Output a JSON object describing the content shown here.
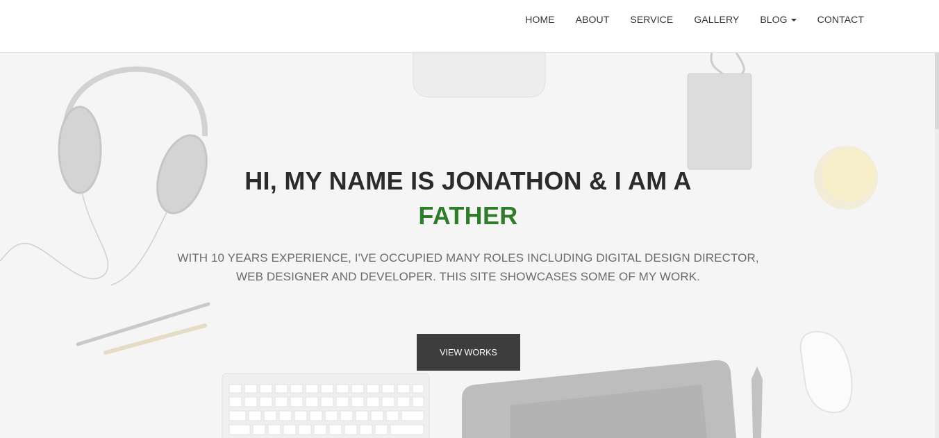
{
  "nav": {
    "items": [
      {
        "label": "HOME"
      },
      {
        "label": "ABOUT"
      },
      {
        "label": "SERVICE"
      },
      {
        "label": "GALLERY"
      },
      {
        "label": "BLOG",
        "has_dropdown": true
      },
      {
        "label": "CONTACT"
      }
    ]
  },
  "hero": {
    "heading_line": "HI, MY NAME IS JONATHON & I AM A",
    "role": "FATHER",
    "description_line1": "WITH 10 YEARS EXPERIENCE, I'VE OCCUPIED MANY ROLES INCLUDING DIGITAL DESIGN DIRECTOR,",
    "description_line2": "WEB DESIGNER AND DEVELOPER. THIS SITE SHOWCASES SOME OF MY WORK.",
    "button_label": "VIEW WORKS"
  },
  "colors": {
    "accent": "#2f7d2a",
    "button_bg": "#3d3d3d",
    "heading": "#2b2b2b",
    "nav_bg": "#ffffff",
    "hero_bg": "#f5f5f5"
  },
  "icons": [
    "caret-down-icon"
  ]
}
